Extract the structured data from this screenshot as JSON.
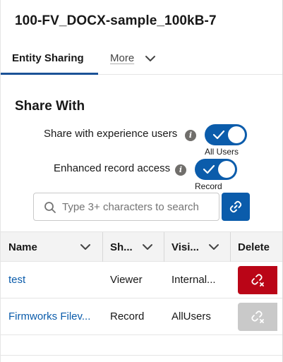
{
  "header": {
    "title": "100-FV_DOCX-sample_100kB-7"
  },
  "tabs": {
    "active_label": "Entity Sharing",
    "more_label": "More"
  },
  "share_with": {
    "title": "Share With",
    "experience_users": {
      "label": "Share with experience users",
      "state": "on",
      "caption": "All Users"
    },
    "enhanced_access": {
      "label": "Enhanced record access",
      "state": "on",
      "caption": "Record"
    }
  },
  "search": {
    "placeholder": "Type 3+ characters to search",
    "value": ""
  },
  "table": {
    "columns": [
      "Name",
      "Sh...",
      "Visi...",
      "Delete"
    ],
    "rows": [
      {
        "name": "test",
        "share": "Viewer",
        "visibility": "Internal...",
        "delete_enabled": true
      },
      {
        "name": "Firmworks Filev...",
        "share": "Record",
        "visibility": "AllUsers",
        "delete_enabled": false
      }
    ]
  },
  "colors": {
    "brand": "#0b5cab",
    "tab_active": "#1b5297",
    "delete": "#ba0517",
    "disabled": "#c9c9c9"
  },
  "icons": [
    "info-icon",
    "check-icon",
    "search-icon",
    "link-icon",
    "unlink-icon",
    "chevron-down-icon"
  ]
}
